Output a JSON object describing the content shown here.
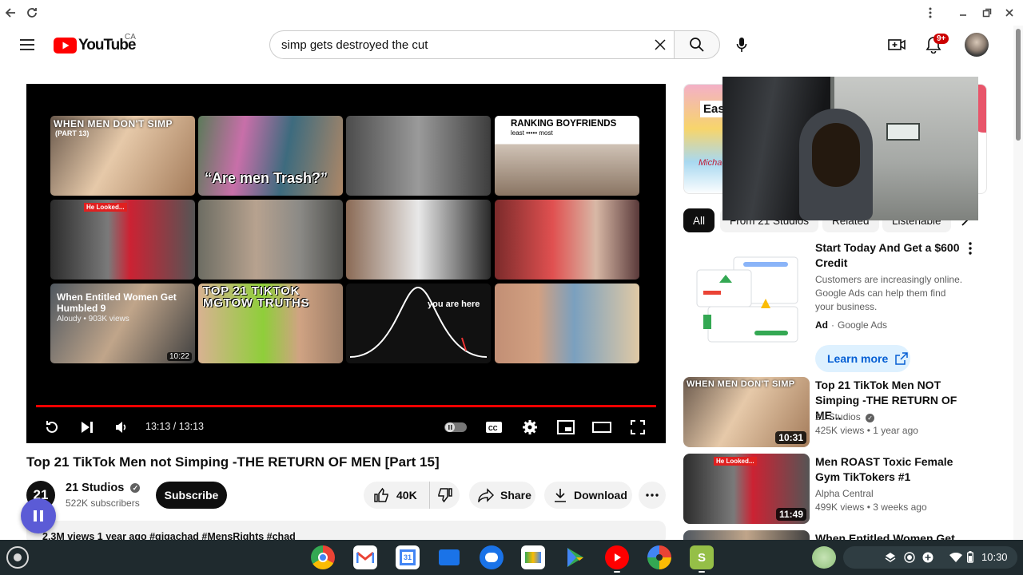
{
  "browser": {
    "tab_title": ""
  },
  "masthead": {
    "logo_text": "YouTube",
    "country": "CA",
    "search_value": "simp gets destroyed the cut",
    "notification_badge": "9+"
  },
  "player": {
    "time": "13:13 / 13:13",
    "progress": 1.0,
    "tiles": [
      {
        "title": "WHEN MEN DON'T SIMP",
        "sub": "(PART 13)"
      },
      {
        "title": "“Are men Trash?”",
        "sub": ""
      },
      {
        "title": "",
        "sub": ""
      },
      {
        "title": "RANKING BOYFRIENDS",
        "sub": "least ••••• most"
      },
      {
        "title": "He Looked...",
        "sub": ""
      },
      {
        "title": "",
        "sub": ""
      },
      {
        "title": "",
        "sub": ""
      },
      {
        "title": "",
        "sub": ""
      },
      {
        "title": "When Entitled Women Get Humbled 9",
        "sub": "Aloudy • 903K views",
        "dur": "10:22"
      },
      {
        "title": "TOP 21 TIKTOK MGTOW TRUTHS",
        "sub": ""
      },
      {
        "title": "you are here",
        "sub": ""
      },
      {
        "title": "",
        "sub": ""
      }
    ]
  },
  "video": {
    "title": "Top 21 TikTok Men not Simping -THE RETURN OF MEN [Part 15]",
    "channel_avatar": "21",
    "channel_name": "21 Studios",
    "subscribers": "522K subscribers",
    "subscribe_label": "Subscribe",
    "likes": "40K",
    "share_label": "Share",
    "download_label": "Download",
    "description_preview": "2.3M views  1 year ago  #gigachad #MensRights #chad"
  },
  "sidebar": {
    "banner_text": "Eas",
    "banner_brand": "Michae",
    "chips": [
      "All",
      "From 21 Studios",
      "Related",
      "Listenable"
    ],
    "ad": {
      "title": "Start Today And Get a $600 Credit",
      "description": "Customers are increasingly online. Google Ads can help them find your business.",
      "ad_label": "Ad",
      "advertiser": "Google Ads",
      "learn_more": "Learn more"
    },
    "recommendations": [
      {
        "title": "Top 21 TikTok Men NOT Simping -THE RETURN OF ME...",
        "channel": "21 Studios",
        "verified": true,
        "meta": "425K views • 1 year ago",
        "duration": "10:31",
        "thumb_text": "WHEN MEN DON'T SIMP"
      },
      {
        "title": "Men ROAST Toxic Female Gym TikTokers #1",
        "channel": "Alpha Central",
        "verified": false,
        "meta": "499K views • 3 weeks ago",
        "duration": "11:49",
        "thumb_text": "He Looked..."
      },
      {
        "title": "When Entitled Women Get",
        "channel": "",
        "verified": false,
        "meta": "",
        "duration": "",
        "thumb_text": ""
      }
    ]
  },
  "shelf": {
    "time": "10:30",
    "apps": [
      "chrome-icon",
      "gmail-icon",
      "calendar-icon",
      "files-icon",
      "messages-icon",
      "meet-icon",
      "play-store-icon",
      "youtube-icon",
      "photos-icon",
      "shopify-icon"
    ]
  },
  "colors": {
    "brand_red": "#ff0000",
    "accent_blue": "#065fd4",
    "shelf_bg": "#1f2a2e"
  }
}
